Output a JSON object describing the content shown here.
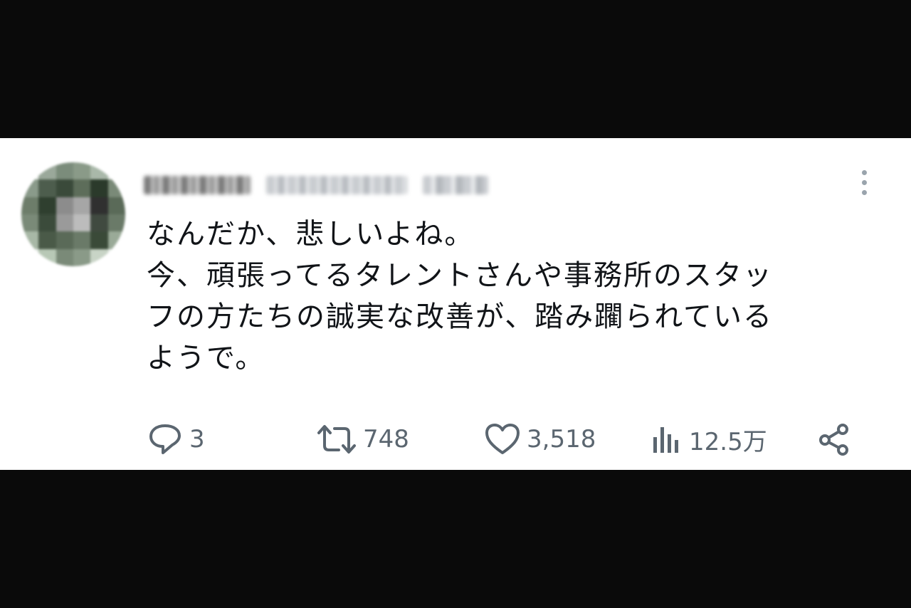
{
  "tweet": {
    "text_lines": [
      "なんだか、悲しいよね。",
      "今、頑張ってるタレントさんや事務所のスタッ",
      "フの方たちの誠実な改善が、踏み躙られている",
      "ようで。"
    ]
  },
  "actions": {
    "reply": {
      "icon": "reply-icon",
      "count": "3"
    },
    "retweet": {
      "icon": "retweet-icon",
      "count": "748"
    },
    "like": {
      "icon": "heart-icon",
      "count": "3,518"
    },
    "views": {
      "icon": "bar-chart-icon",
      "count": "12.5万"
    },
    "share": {
      "icon": "share-icon"
    }
  },
  "colors": {
    "text": "#111418",
    "icon": "#5b6670",
    "card_bg": "#ffffff",
    "letterbox": "#0a0a0a"
  }
}
